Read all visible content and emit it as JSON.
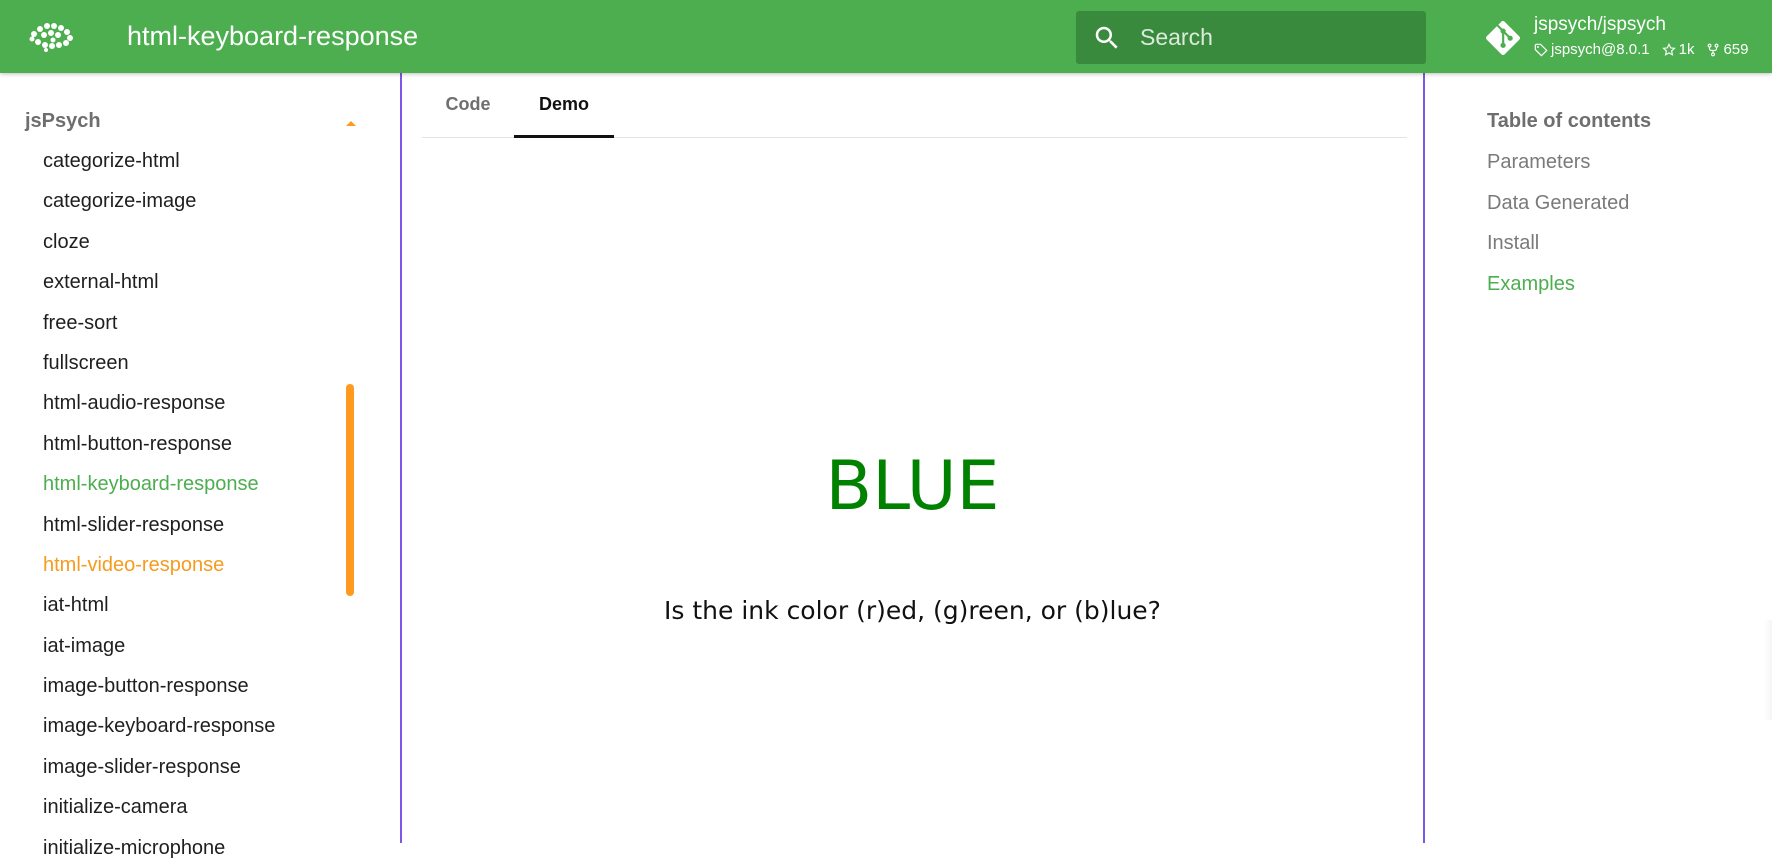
{
  "header": {
    "site_title": "html-keyboard-response",
    "search_placeholder": "Search",
    "repo": {
      "name": "jspsych/jspsych",
      "version": "jspsych@8.0.1",
      "stars": "1k",
      "forks": "659"
    }
  },
  "sidebar": {
    "section_title": "jsPsych",
    "items": [
      {
        "label": "categorize-html"
      },
      {
        "label": "categorize-image"
      },
      {
        "label": "cloze"
      },
      {
        "label": "external-html"
      },
      {
        "label": "free-sort"
      },
      {
        "label": "fullscreen"
      },
      {
        "label": "html-audio-response"
      },
      {
        "label": "html-button-response"
      },
      {
        "label": "html-keyboard-response"
      },
      {
        "label": "html-slider-response"
      },
      {
        "label": "html-video-response"
      },
      {
        "label": "iat-html"
      },
      {
        "label": "iat-image"
      },
      {
        "label": "image-button-response"
      },
      {
        "label": "image-keyboard-response"
      },
      {
        "label": "image-slider-response"
      },
      {
        "label": "initialize-camera"
      },
      {
        "label": "initialize-microphone"
      }
    ],
    "active_item": "html-keyboard-response",
    "hover_item": "html-video-response"
  },
  "main": {
    "tabs": [
      {
        "label": "Code"
      },
      {
        "label": "Demo"
      }
    ],
    "active_tab": "Demo",
    "demo": {
      "stimulus_word": "BLUE",
      "stimulus_color": "#018100",
      "prompt": "Is the ink color (r)ed, (g)reen, or (b)lue?"
    }
  },
  "toc": {
    "title": "Table of contents",
    "items": [
      {
        "label": "Parameters"
      },
      {
        "label": "Data Generated"
      },
      {
        "label": "Install"
      },
      {
        "label": "Examples"
      }
    ],
    "active_item": "Examples"
  },
  "colors": {
    "primary": "#4cae4f",
    "accent": "#ff9a1f",
    "frame_border": "#7e57e8"
  }
}
